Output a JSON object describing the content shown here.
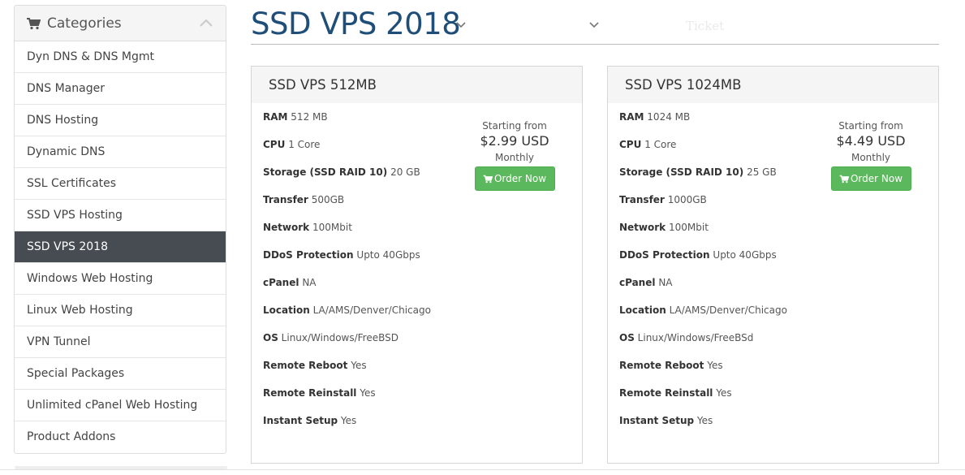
{
  "sidebar": {
    "title": "Categories",
    "items": [
      {
        "label": "Dyn DNS & DNS Mgmt",
        "active": false
      },
      {
        "label": "DNS Manager",
        "active": false
      },
      {
        "label": "DNS Hosting",
        "active": false
      },
      {
        "label": "Dynamic DNS",
        "active": false
      },
      {
        "label": "SSL Certificates",
        "active": false
      },
      {
        "label": "SSD VPS Hosting",
        "active": false
      },
      {
        "label": "SSD VPS 2018",
        "active": true
      },
      {
        "label": "Windows Web Hosting",
        "active": false
      },
      {
        "label": "Linux Web Hosting",
        "active": false
      },
      {
        "label": "VPN Tunnel",
        "active": false
      },
      {
        "label": "Special Packages",
        "active": false
      },
      {
        "label": "Unlimited cPanel Web Hosting",
        "active": false
      },
      {
        "label": "Product Addons",
        "active": false
      }
    ]
  },
  "header": {
    "title": "SSD VPS 2018",
    "ghost_text": "Ticket"
  },
  "colors": {
    "accent_title": "#1f4e79",
    "active_item": "#464c52",
    "order_button": "#5cb85c"
  },
  "products": [
    {
      "name": "SSD VPS 512MB",
      "starting_label": "Starting from",
      "price": "$2.99 USD",
      "cycle": "Monthly",
      "order_label": "Order Now",
      "features": [
        {
          "label": "RAM",
          "value": "512 MB"
        },
        {
          "label": "CPU",
          "value": "1 Core"
        },
        {
          "label": "Storage (SSD RAID 10)",
          "value": "20 GB"
        },
        {
          "label": "Transfer",
          "value": "500GB"
        },
        {
          "label": "Network",
          "value": "100Mbit"
        },
        {
          "label": "DDoS Protection",
          "value": "Upto 40Gbps"
        },
        {
          "label": "cPanel",
          "value": "NA"
        },
        {
          "label": "Location",
          "value": "LA/AMS/Denver/Chicago"
        },
        {
          "label": "OS",
          "value": "Linux/Windows/FreeBSD"
        },
        {
          "label": "Remote Reboot",
          "value": "Yes"
        },
        {
          "label": "Remote Reinstall",
          "value": "Yes"
        },
        {
          "label": "Instant Setup",
          "value": "Yes"
        }
      ]
    },
    {
      "name": "SSD VPS 1024MB",
      "starting_label": "Starting from",
      "price": "$4.49 USD",
      "cycle": "Monthly",
      "order_label": "Order Now",
      "features": [
        {
          "label": "RAM",
          "value": "1024 MB"
        },
        {
          "label": "CPU",
          "value": "1 Core"
        },
        {
          "label": "Storage (SSD RAID 10)",
          "value": "25 GB"
        },
        {
          "label": "Transfer",
          "value": "1000GB"
        },
        {
          "label": "Network",
          "value": "100Mbit"
        },
        {
          "label": "DDoS Protection",
          "value": "Upto 40Gbps"
        },
        {
          "label": "cPanel",
          "value": "NA"
        },
        {
          "label": "Location",
          "value": "LA/AMS/Denver/Chicago"
        },
        {
          "label": "OS",
          "value": "Linux/Windows/FreeBSd"
        },
        {
          "label": "Remote Reboot",
          "value": "Yes"
        },
        {
          "label": "Remote Reinstall",
          "value": "Yes"
        },
        {
          "label": "Instant Setup",
          "value": "Yes"
        }
      ]
    }
  ]
}
